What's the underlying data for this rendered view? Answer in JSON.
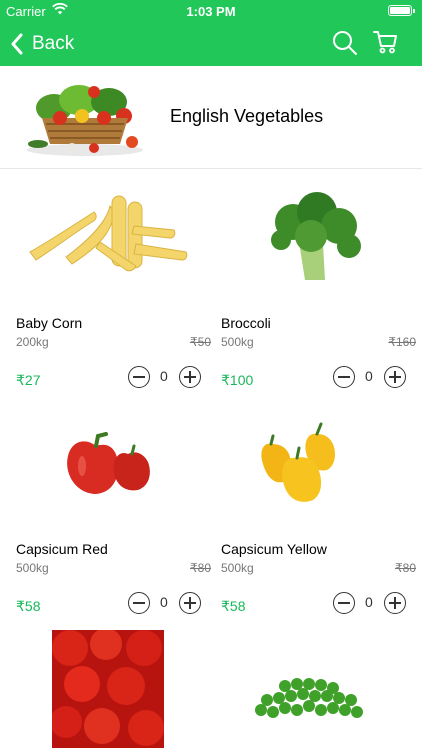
{
  "status_bar": {
    "carrier": "Carrier",
    "time": "1:03 PM"
  },
  "nav": {
    "back_label": "Back",
    "search_icon": "search-icon",
    "cart_icon": "cart-icon"
  },
  "category": {
    "title": "English Vegetables"
  },
  "products": [
    {
      "name": "Baby Corn",
      "qty": "200kg",
      "mrp": "₹50",
      "price": "₹27",
      "count": "0"
    },
    {
      "name": "Broccoli",
      "qty": "500kg",
      "mrp": "₹160",
      "price": "₹100",
      "count": "0"
    },
    {
      "name": "Capsicum Red",
      "qty": "500kg",
      "mrp": "₹80",
      "price": "₹58",
      "count": "0"
    },
    {
      "name": "Capsicum Yellow",
      "qty": "500kg",
      "mrp": "₹80",
      "price": "₹58",
      "count": "0"
    }
  ],
  "colors": {
    "header": "#22c75a",
    "price": "#18b85a"
  }
}
